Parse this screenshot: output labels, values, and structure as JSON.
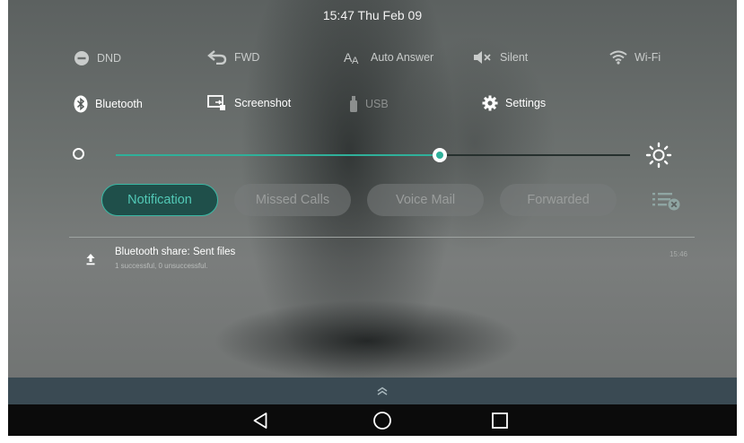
{
  "status_bar": {
    "clock": "15:47 Thu Feb 09"
  },
  "quick_settings": {
    "row1": [
      {
        "label": "DND",
        "icon": "minus-circle-icon",
        "state": "off"
      },
      {
        "label": "FWD",
        "icon": "forward-arrow-icon",
        "state": "off"
      },
      {
        "label": "Auto Answer",
        "icon": "auto-answer-icon",
        "state": "off"
      },
      {
        "label": "Silent",
        "icon": "speaker-mute-icon",
        "state": "off"
      },
      {
        "label": "Wi-Fi",
        "icon": "wifi-icon",
        "state": "off"
      }
    ],
    "row2": [
      {
        "label": "Bluetooth",
        "icon": "bluetooth-icon",
        "state": "on"
      },
      {
        "label": "Screenshot",
        "icon": "screenshot-icon",
        "state": "on"
      },
      {
        "label": "USB",
        "icon": "usb-icon",
        "state": "disabled"
      },
      {
        "label": "Settings",
        "icon": "gear-icon",
        "state": "on"
      }
    ]
  },
  "brightness": {
    "level": 0.63,
    "low_icon": "brightness-low-icon",
    "high_icon": "brightness-high-icon"
  },
  "tabs": [
    {
      "label": "Notification",
      "active": true
    },
    {
      "label": "Missed Calls",
      "active": false
    },
    {
      "label": "Voice Mail",
      "active": false
    },
    {
      "label": "Forwarded",
      "active": false
    }
  ],
  "clear_all_icon": "clear-list-icon",
  "notifications": [
    {
      "icon": "upload-icon",
      "title": "Bluetooth share: Sent files",
      "body": "1 successful, 0 unsuccessful.",
      "time": "15:46"
    }
  ],
  "handle_icon": "chevron-up-double-icon",
  "nav_bar": {
    "back": "back-triangle-icon",
    "home": "home-circle-icon",
    "recents": "recents-square-icon"
  },
  "colors": {
    "accent": "#2fb09a",
    "handle_bar": "#3a4a53",
    "nav_bar": "#0b0b0b"
  }
}
